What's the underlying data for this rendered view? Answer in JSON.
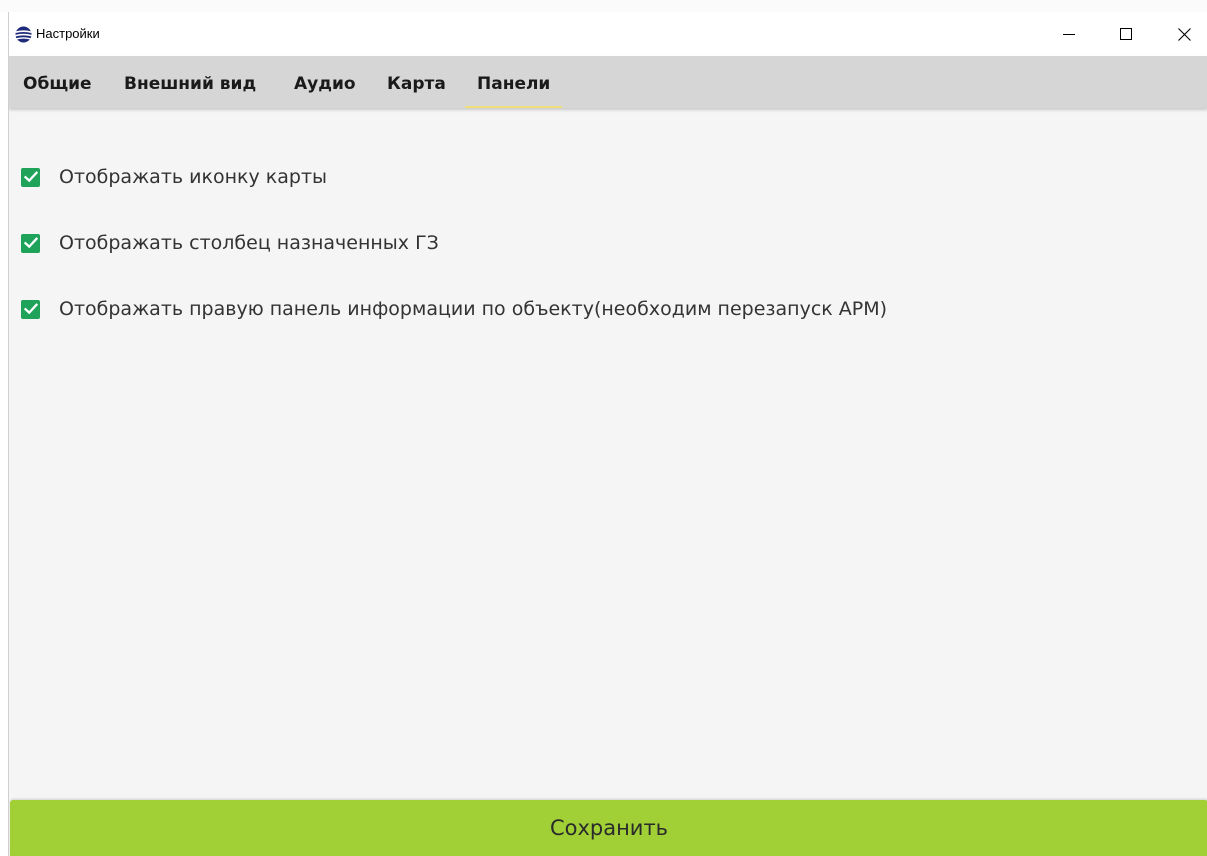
{
  "window": {
    "title": "Настройки",
    "icon": "globe-app-icon",
    "controls": [
      "minimize-icon",
      "maximize-icon",
      "close-icon"
    ]
  },
  "tabs": [
    {
      "label": "Общие",
      "active": false
    },
    {
      "label": "Внешний вид",
      "active": false
    },
    {
      "label": "Аудио",
      "active": false
    },
    {
      "label": "Карта",
      "active": false
    },
    {
      "label": "Панели",
      "active": true
    }
  ],
  "options": [
    {
      "label": "Отображать иконку карты",
      "checked": true
    },
    {
      "label": "Отображать столбец назначенных ГЗ",
      "checked": true
    },
    {
      "label": "Отображать правую панель информации по объекту(необходим перезапуск АРМ)",
      "checked": true
    }
  ],
  "save_button": {
    "label": "Сохранить"
  },
  "colors": {
    "accent_green": "#a0d036",
    "checkbox_green": "#1fa35a",
    "tab_underline": "#f0e07a",
    "tabbar_bg": "#d6d6d6",
    "content_bg": "#f5f5f5"
  }
}
